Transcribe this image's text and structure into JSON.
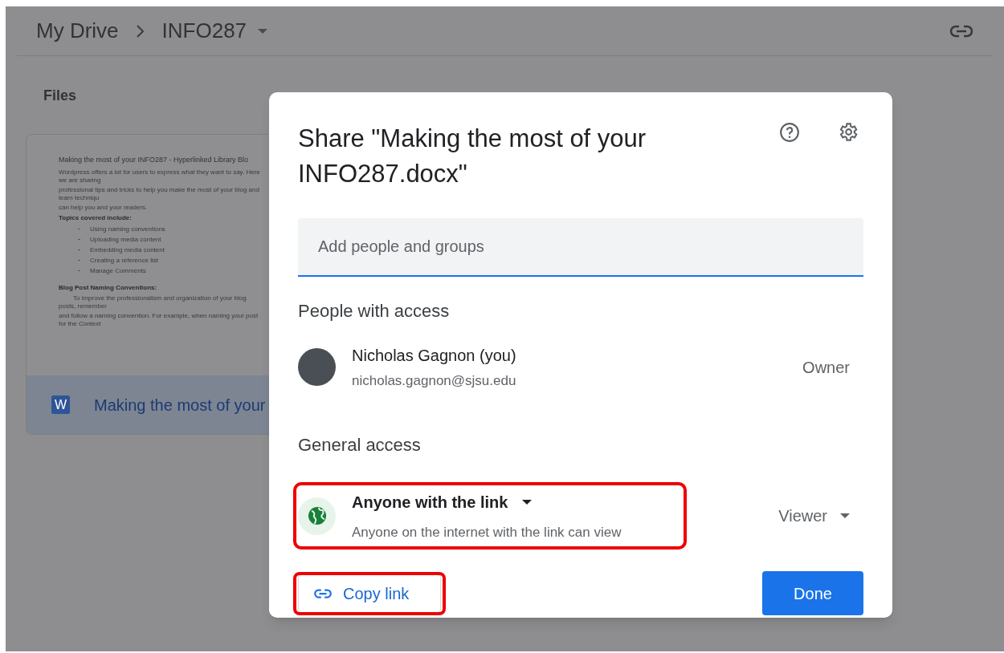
{
  "breadcrumb": {
    "items": [
      "My Drive",
      "INFO287"
    ]
  },
  "section_title": "Files",
  "file_card": {
    "preview_lines": [
      {
        "kind": "title",
        "text": "Making the most of your INFO287 - Hyperlinked Library Blo"
      },
      {
        "kind": "text",
        "text": "Wordpress offers a lot for users to express what they want to say. Here we are sharing"
      },
      {
        "kind": "text",
        "text": "professional tips and tricks to help you make the most of your blog and learn techniqu"
      },
      {
        "kind": "text",
        "text": "can help you and your readers."
      },
      {
        "kind": "heading",
        "text": "Topics covered include:"
      },
      {
        "kind": "bullet",
        "text": "Using naming conventions"
      },
      {
        "kind": "bullet",
        "text": "Uploading media content"
      },
      {
        "kind": "bullet",
        "text": "Embedding media content"
      },
      {
        "kind": "bullet",
        "text": "Creating a reference list"
      },
      {
        "kind": "bullet",
        "text": "Manage Comments"
      },
      {
        "kind": "gap_heading",
        "text": "Blog Post Naming Conventions:"
      },
      {
        "kind": "indent",
        "text": "To improve the professionalism and organization of your blog posts, remember"
      },
      {
        "kind": "text",
        "text": "and follow a naming convention. For example, when naming your post for the Context"
      }
    ],
    "file_icon": "W",
    "file_name": "Making the most of your"
  },
  "dialog": {
    "title": "Share \"Making the most of your INFO287.docx\"",
    "add_field": {
      "placeholder": "Add people and groups"
    },
    "people_heading": "People with access",
    "people": [
      {
        "name": "Nicholas Gagnon (you)",
        "email": "nicholas.gagnon@sjsu.edu",
        "role": "Owner"
      }
    ],
    "general_heading": "General access",
    "access": {
      "label": "Anyone with the link",
      "description": "Anyone on the internet with the link can view",
      "role": "Viewer"
    },
    "copy_link": "Copy link",
    "done": "Done"
  }
}
